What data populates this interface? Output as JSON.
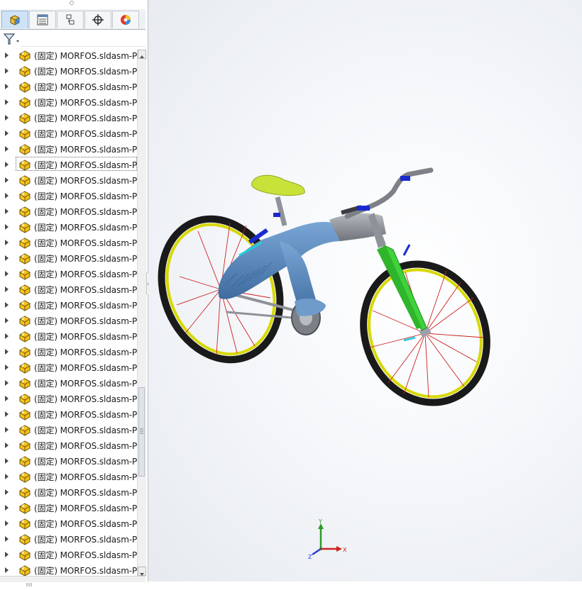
{
  "tabs": [
    {
      "name": "feature-manager",
      "icon": "feature-tree-icon"
    },
    {
      "name": "property-manager",
      "icon": "property-list-icon"
    },
    {
      "name": "configuration-manager",
      "icon": "configuration-icon"
    },
    {
      "name": "dimxpert-manager",
      "icon": "crosshair-icon"
    },
    {
      "name": "display-manager",
      "icon": "appearance-icon"
    }
  ],
  "filter": {
    "icon": "filter-icon"
  },
  "tree": {
    "item_label": "(固定) MORFOS.sldasm-P",
    "items": [
      "(固定) MORFOS.sldasm-P",
      "(固定) MORFOS.sldasm-P",
      "(固定) MORFOS.sldasm-P",
      "(固定) MORFOS.sldasm-P",
      "(固定) MORFOS.sldasm-P",
      "(固定) MORFOS.sldasm-P",
      "(固定) MORFOS.sldasm-P",
      "(固定) MORFOS.sldasm-P",
      "(固定) MORFOS.sldasm-P",
      "(固定) MORFOS.sldasm-P",
      "(固定) MORFOS.sldasm-P",
      "(固定) MORFOS.sldasm-P",
      "(固定) MORFOS.sldasm-P",
      "(固定) MORFOS.sldasm-P",
      "(固定) MORFOS.sldasm-P",
      "(固定) MORFOS.sldasm-P",
      "(固定) MORFOS.sldasm-P",
      "(固定) MORFOS.sldasm-P",
      "(固定) MORFOS.sldasm-P",
      "(固定) MORFOS.sldasm-P",
      "(固定) MORFOS.sldasm-P",
      "(固定) MORFOS.sldasm-P",
      "(固定) MORFOS.sldasm-P",
      "(固定) MORFOS.sldasm-P",
      "(固定) MORFOS.sldasm-P",
      "(固定) MORFOS.sldasm-P",
      "(固定) MORFOS.sldasm-P",
      "(固定) MORFOS.sldasm-P",
      "(固定) MORFOS.sldasm-P",
      "(固定) MORFOS.sldasm-P",
      "(固定) MORFOS.sldasm-P",
      "(固定) MORFOS.sldasm-P",
      "(固定) MORFOS.sldasm-P",
      "(固定) MORFOS.sldasm-P"
    ],
    "selected_index": 7
  },
  "triad": {
    "x_label": "X",
    "y_label": "Y",
    "z_label": "Z"
  },
  "colors": {
    "frame_blue": "#5a8bc0",
    "seat_yellow": "#c9e23a",
    "fork_green": "#3fd23a",
    "rim_yellow": "#d8d800",
    "tire_black": "#1a1a1a",
    "spoke_red": "#d02020",
    "clamp_blue": "#1a2ad0"
  }
}
